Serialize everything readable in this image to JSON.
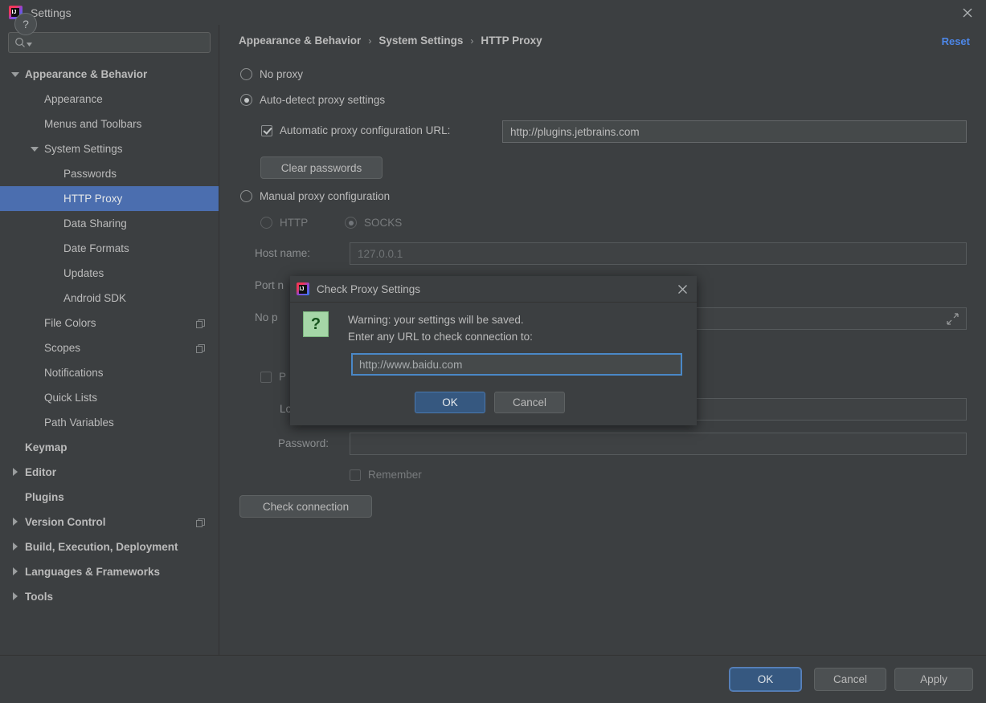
{
  "window": {
    "title": "Settings",
    "close_icon": "close-icon",
    "logo_icon": "intellij-logo-icon"
  },
  "search": {
    "placeholder": "",
    "value": "",
    "icon": "search-icon"
  },
  "sidebar": {
    "items": [
      {
        "label": "Appearance & Behavior",
        "indent": 0,
        "arrow": "down",
        "bold": true,
        "selected": false,
        "badge": false
      },
      {
        "label": "Appearance",
        "indent": 1,
        "arrow": "none",
        "bold": false,
        "selected": false,
        "badge": false
      },
      {
        "label": "Menus and Toolbars",
        "indent": 1,
        "arrow": "none",
        "bold": false,
        "selected": false,
        "badge": false
      },
      {
        "label": "System Settings",
        "indent": 1,
        "arrow": "down",
        "bold": false,
        "selected": false,
        "badge": false
      },
      {
        "label": "Passwords",
        "indent": 2,
        "arrow": "none",
        "bold": false,
        "selected": false,
        "badge": false
      },
      {
        "label": "HTTP Proxy",
        "indent": 2,
        "arrow": "none",
        "bold": false,
        "selected": true,
        "badge": false
      },
      {
        "label": "Data Sharing",
        "indent": 2,
        "arrow": "none",
        "bold": false,
        "selected": false,
        "badge": false
      },
      {
        "label": "Date Formats",
        "indent": 2,
        "arrow": "none",
        "bold": false,
        "selected": false,
        "badge": false
      },
      {
        "label": "Updates",
        "indent": 2,
        "arrow": "none",
        "bold": false,
        "selected": false,
        "badge": false
      },
      {
        "label": "Android SDK",
        "indent": 2,
        "arrow": "none",
        "bold": false,
        "selected": false,
        "badge": false
      },
      {
        "label": "File Colors",
        "indent": 1,
        "arrow": "none",
        "bold": false,
        "selected": false,
        "badge": true
      },
      {
        "label": "Scopes",
        "indent": 1,
        "arrow": "none",
        "bold": false,
        "selected": false,
        "badge": true
      },
      {
        "label": "Notifications",
        "indent": 1,
        "arrow": "none",
        "bold": false,
        "selected": false,
        "badge": false
      },
      {
        "label": "Quick Lists",
        "indent": 1,
        "arrow": "none",
        "bold": false,
        "selected": false,
        "badge": false
      },
      {
        "label": "Path Variables",
        "indent": 1,
        "arrow": "none",
        "bold": false,
        "selected": false,
        "badge": false
      },
      {
        "label": "Keymap",
        "indent": 0,
        "arrow": "none",
        "bold": true,
        "selected": false,
        "badge": false
      },
      {
        "label": "Editor",
        "indent": 0,
        "arrow": "right",
        "bold": true,
        "selected": false,
        "badge": false
      },
      {
        "label": "Plugins",
        "indent": 0,
        "arrow": "none",
        "bold": true,
        "selected": false,
        "badge": false
      },
      {
        "label": "Version Control",
        "indent": 0,
        "arrow": "right",
        "bold": true,
        "selected": false,
        "badge": true
      },
      {
        "label": "Build, Execution, Deployment",
        "indent": 0,
        "arrow": "right",
        "bold": true,
        "selected": false,
        "badge": false
      },
      {
        "label": "Languages & Frameworks",
        "indent": 0,
        "arrow": "right",
        "bold": true,
        "selected": false,
        "badge": false
      },
      {
        "label": "Tools",
        "indent": 0,
        "arrow": "right",
        "bold": true,
        "selected": false,
        "badge": false
      }
    ]
  },
  "breadcrumb": {
    "crumb1": "Appearance & Behavior",
    "crumb2": "System Settings",
    "crumb3": "HTTP Proxy",
    "separator": "›"
  },
  "reset": {
    "label": "Reset"
  },
  "proxy": {
    "no_proxy_label": "No proxy",
    "no_proxy_selected": false,
    "auto_detect_label": "Auto-detect proxy settings",
    "auto_detect_selected": true,
    "pac_checkbox_label": "Automatic proxy configuration URL:",
    "pac_checked": true,
    "pac_url": "http://plugins.jetbrains.com",
    "clear_passwords_label": "Clear passwords",
    "manual_label": "Manual proxy configuration",
    "manual_selected": false,
    "http_label": "HTTP",
    "http_selected": false,
    "socks_label": "SOCKS",
    "socks_selected": true,
    "host_name_label": "Host name:",
    "host_name_value": "127.0.0.1",
    "port_label": "Port n",
    "no_proxy_for_label": "No p",
    "no_proxy_for_value": "",
    "expand_icon": "expand-icon",
    "auth_checkbox_label": "P",
    "auth_checked": false,
    "login_label": "Lo",
    "login_value": "",
    "password_label": "Password:",
    "password_value": "",
    "remember_label": "Remember",
    "remember_checked": false,
    "check_connection_label": "Check connection"
  },
  "bottom": {
    "help_label": "?",
    "ok_label": "OK",
    "cancel_label": "Cancel",
    "apply_label": "Apply"
  },
  "dialog": {
    "title": "Check Proxy Settings",
    "logo_icon": "intellij-logo-icon",
    "close_icon": "close-icon",
    "icon": "question-icon",
    "icon_glyph": "?",
    "message_line1": "Warning: your settings will be saved.",
    "message_line2": "Enter any URL to check connection to:",
    "input_value": "http://www.baidu.com",
    "ok_label": "OK",
    "cancel_label": "Cancel"
  },
  "colors": {
    "background": "#3c3f41",
    "selection": "#4b6eaf",
    "accent_link": "#4d87e8",
    "primary_button": "#365880",
    "question_icon": "#a5d6a7"
  }
}
